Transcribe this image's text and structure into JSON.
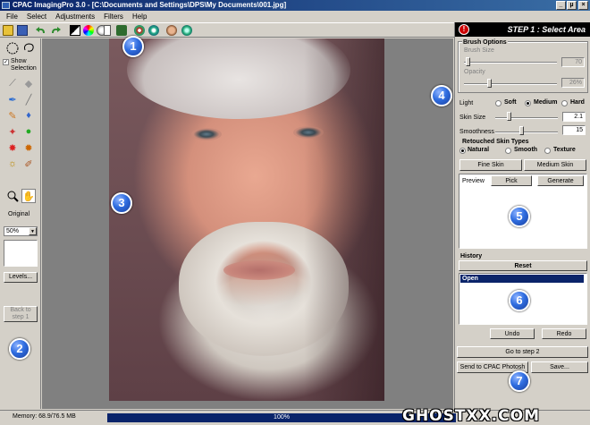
{
  "window": {
    "title": "CPAC ImagingPro 3.0 - [C:\\Documents and Settings\\DPS\\My Documents\\001.jpg]",
    "controls": [
      "_",
      "µ",
      "×"
    ]
  },
  "menu": [
    "File",
    "Select",
    "Adjustments",
    "Filters",
    "Help"
  ],
  "left_panel": {
    "show_selection_label": "Show Selection",
    "original_label": "Original",
    "zoom_value": "50%",
    "levels_label": "Levels...",
    "back_label": "Back to step 1"
  },
  "right_panel": {
    "step_icon": "!",
    "step_title": "STEP 1 : Select Area",
    "brush": {
      "header": "Brush Options",
      "size_label": "Brush Size",
      "size_value": "70",
      "opacity_label": "Opacity",
      "opacity_value": "26%"
    },
    "light": {
      "label": "Light",
      "options": [
        "Soft",
        "Medium",
        "Hard"
      ],
      "selected": "Medium"
    },
    "skin_size": {
      "label": "Skin Size",
      "value": "2.1"
    },
    "smoothness": {
      "label": "Smoothness",
      "value": "15"
    },
    "skin_types": {
      "header": "Retouched Skin Types",
      "options": [
        "Natural",
        "Smooth",
        "Texture"
      ],
      "selected": "Natural"
    },
    "buttons": {
      "fine_skin": "Fine Skin",
      "medium_skin": "Medium Skin",
      "preview_label": "Preview",
      "pick": "Pick",
      "generate": "Generate",
      "reset": "Reset",
      "undo": "Undo",
      "redo": "Redo",
      "go_step2": "Go to step 2",
      "send_cpac": "Send to CPAC Photosh",
      "save": "Save..."
    },
    "history": {
      "header": "History",
      "items": [
        "Open"
      ]
    }
  },
  "status": {
    "memory": "Memory: 68.9/76.5 MB",
    "progress": "100%"
  },
  "markers": [
    "1",
    "2",
    "3",
    "4",
    "5",
    "6",
    "7"
  ],
  "watermark": "GHOSTXX.COM",
  "colors": {
    "title_bar": "#0a246a",
    "marker_blue": "#2f6de0",
    "face_bg": "#5e4046",
    "step_header": "#000000"
  }
}
